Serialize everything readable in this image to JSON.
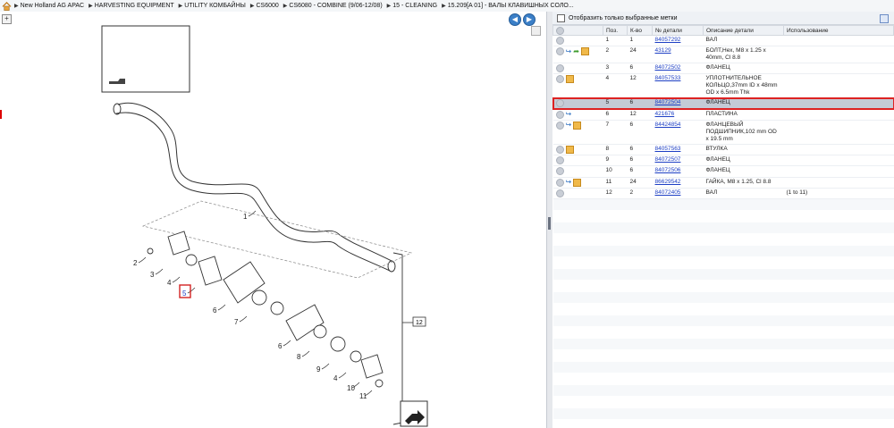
{
  "breadcrumb": [
    {
      "label": "New Holland AG APAC"
    },
    {
      "label": "HARVESTING EQUIPMENT"
    },
    {
      "label": "UTILITY КОМБАЙНЫ"
    },
    {
      "label": "CS6000"
    },
    {
      "label": "CS6080 - COMBINE (9/06-12/08)"
    },
    {
      "label": "15 - CLEANING"
    },
    {
      "label": "15.209[A 01] - ВАЛЫ КЛАВИШНЫХ СОЛО..."
    }
  ],
  "diagram": {
    "callouts": [
      "1",
      "2",
      "3",
      "4",
      "5",
      "6",
      "7",
      "6",
      "8",
      "9",
      "4",
      "10",
      "11"
    ],
    "group_label": "12",
    "highlight": "5"
  },
  "filter": {
    "label": "Отобразить только выбранные метки"
  },
  "table": {
    "headers": [
      "",
      "Поз.",
      "К-во",
      "№ детали",
      "Описание детали",
      "Использование"
    ],
    "rows": [
      {
        "pos": "1",
        "qty": "1",
        "part": "84057292",
        "desc": "ВАЛ",
        "usage": "",
        "icons": [
          "dot"
        ]
      },
      {
        "pos": "2",
        "qty": "24",
        "part": "43129",
        "desc": "БОЛТ,Hex, M8 x 1.25 x 40mm, Cl 8.8",
        "usage": "",
        "icons": [
          "dot",
          "blue",
          "green",
          "box"
        ]
      },
      {
        "pos": "3",
        "qty": "6",
        "part": "84072502",
        "desc": "ФЛАНЕЦ",
        "usage": "",
        "icons": [
          "dot"
        ]
      },
      {
        "pos": "4",
        "qty": "12",
        "part": "84057533",
        "desc": "УПЛОТНИТЕЛЬНОЕ КОЛЬЦО,37mm ID x 48mm OD x 6.5mm Thk",
        "usage": "",
        "icons": [
          "dot",
          "box"
        ]
      },
      {
        "pos": "5",
        "qty": "6",
        "part": "84072504",
        "desc": "ФЛАНЕЦ",
        "usage": "",
        "icons": [
          "dot"
        ],
        "selected": true
      },
      {
        "pos": "6",
        "qty": "12",
        "part": "421676",
        "desc": "ПЛАСТИНА",
        "usage": "",
        "icons": [
          "dot",
          "blue"
        ]
      },
      {
        "pos": "7",
        "qty": "6",
        "part": "84424854",
        "desc": "ФЛАНЦЕВЫЙ ПОДШИПНИК,102 mm OD x 19.5 mm",
        "usage": "",
        "icons": [
          "dot",
          "blue",
          "box"
        ]
      },
      {
        "pos": "8",
        "qty": "6",
        "part": "84057563",
        "desc": "ВТУЛКА",
        "usage": "",
        "icons": [
          "dot",
          "box"
        ]
      },
      {
        "pos": "9",
        "qty": "6",
        "part": "84072507",
        "desc": "ФЛАНЕЦ",
        "usage": "",
        "icons": [
          "dot"
        ]
      },
      {
        "pos": "10",
        "qty": "6",
        "part": "84072506",
        "desc": "ФЛАНЕЦ",
        "usage": "",
        "icons": [
          "dot"
        ]
      },
      {
        "pos": "11",
        "qty": "24",
        "part": "86629542",
        "desc": "ГАЙКА, M8 x 1.25, Cl 8.8",
        "usage": "",
        "icons": [
          "dot",
          "blue",
          "box"
        ]
      },
      {
        "pos": "12",
        "qty": "2",
        "part": "84072405",
        "desc": "ВАЛ",
        "usage": "(1 to 11)",
        "icons": [
          "dot"
        ]
      }
    ]
  },
  "colors": {
    "accent": "#3b7fc7",
    "selection_outline": "#d22222",
    "link": "#1d3fc4"
  }
}
